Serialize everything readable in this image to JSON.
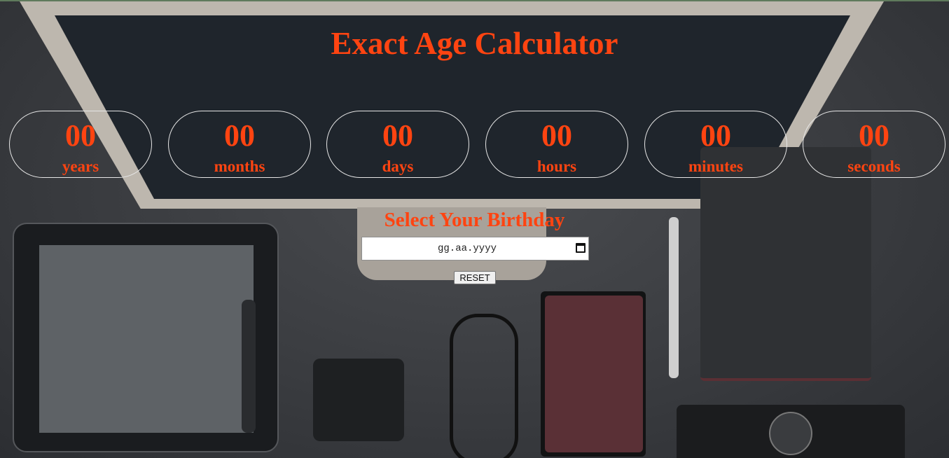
{
  "app": {
    "title": "Exact Age Calculator"
  },
  "counters": [
    {
      "value": "00",
      "label": "years"
    },
    {
      "value": "00",
      "label": "months"
    },
    {
      "value": "00",
      "label": "days"
    },
    {
      "value": "00",
      "label": "hours"
    },
    {
      "value": "00",
      "label": "minutes"
    },
    {
      "value": "00",
      "label": "seconds"
    }
  ],
  "birthday": {
    "label": "Select Your Birthday",
    "date_placeholder": "gg.aa.yyyy",
    "icon": "calendar-icon"
  },
  "actions": {
    "reset_label": "RESET"
  },
  "colors": {
    "accent": "#ff4411",
    "counter_border": "#e6e6e6"
  }
}
